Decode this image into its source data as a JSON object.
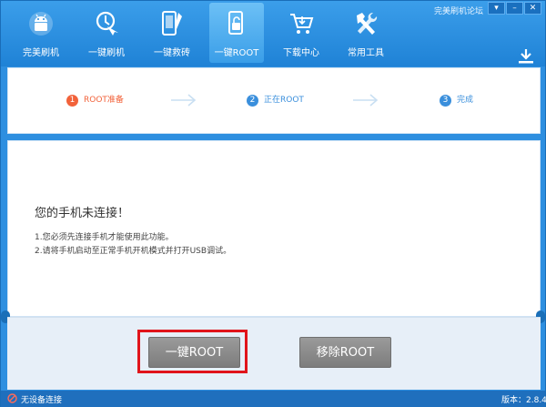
{
  "toolbar": {
    "tools": [
      {
        "label": "完美刷机",
        "icon": "android-robot-icon"
      },
      {
        "label": "一键刷机",
        "icon": "one-click-flash-icon"
      },
      {
        "label": "一键救砖",
        "icon": "phone-repair-icon"
      },
      {
        "label": "一键ROOT",
        "icon": "root-unlock-icon",
        "active": true
      },
      {
        "label": "下载中心",
        "icon": "shopping-cart-icon"
      },
      {
        "label": "常用工具",
        "icon": "tools-icon"
      }
    ],
    "forum_link": "完美刷机论坛",
    "window_buttons": [
      "▾",
      "–",
      "✕"
    ]
  },
  "steps": [
    {
      "num": "1",
      "label": "ROOT准备",
      "state": "active"
    },
    {
      "num": "2",
      "label": "正在ROOT",
      "state": "pending"
    },
    {
      "num": "3",
      "label": "完成",
      "state": "pending"
    }
  ],
  "message": {
    "title": "您的手机未连接！",
    "lines": [
      "1.您必须先连接手机才能使用此功能。",
      "2.请将手机启动至正常手机开机模式并打开USB调试。"
    ]
  },
  "buttons": {
    "root": "一键ROOT",
    "unroot": "移除ROOT"
  },
  "status": {
    "text": "无设备连接",
    "version": "版本：2.8.4"
  },
  "colors": {
    "toolbar": "#1f82d6",
    "step_active": "#f2623a",
    "step_pending": "#3a8fdc",
    "highlight": "#e0141b"
  }
}
